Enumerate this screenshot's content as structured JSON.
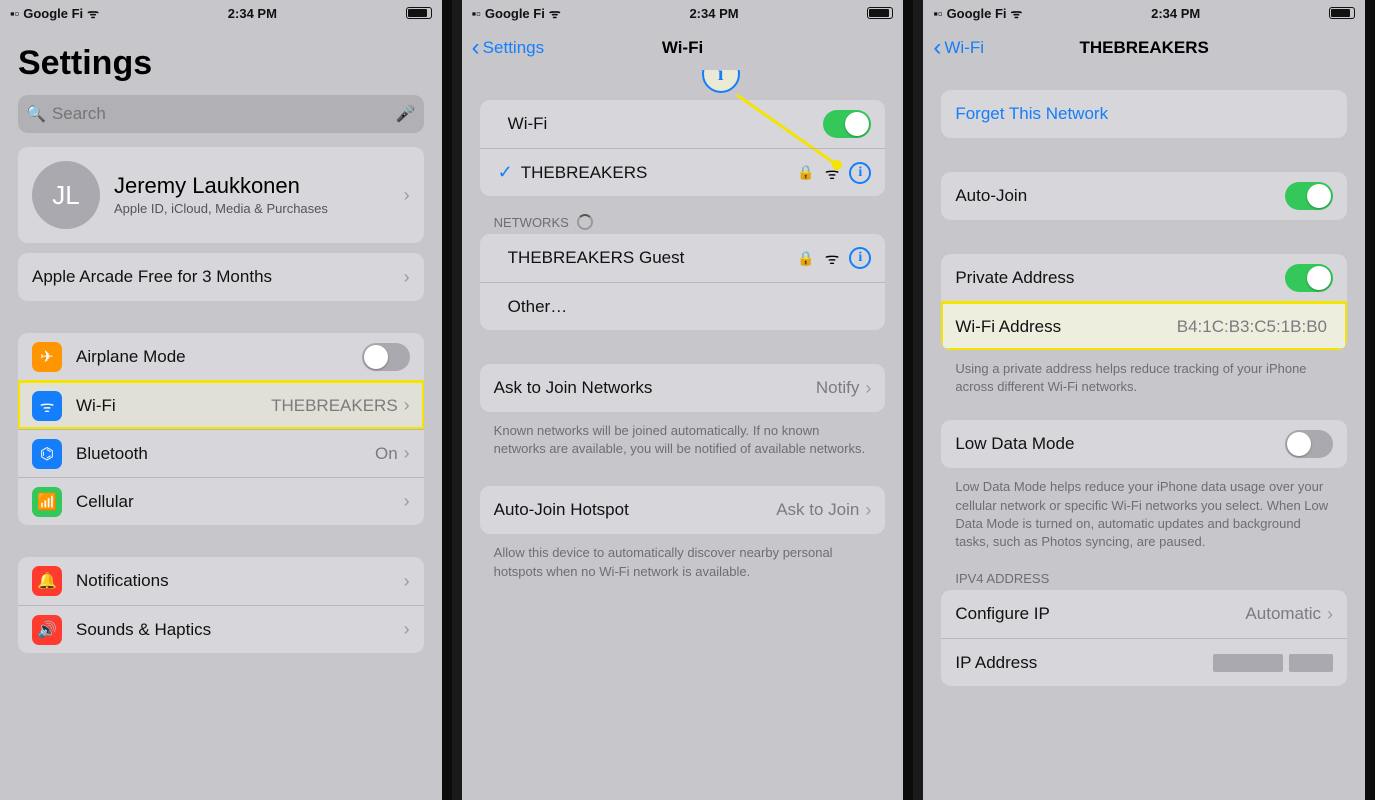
{
  "status": {
    "carrier": "Google Fi",
    "time": "2:34 PM"
  },
  "p1": {
    "bigTitle": "Settings",
    "searchPlaceholder": "Search",
    "account": {
      "initials": "JL",
      "name": "Jeremy Laukkonen",
      "sub": "Apple ID, iCloud, Media & Purchases"
    },
    "promo": "Apple Arcade Free for 3 Months",
    "rows": {
      "airplane": "Airplane Mode",
      "wifi": "Wi-Fi",
      "wifiVal": "THEBREAKERS",
      "bt": "Bluetooth",
      "btVal": "On",
      "cell": "Cellular",
      "notif": "Notifications",
      "sounds": "Sounds & Haptics"
    }
  },
  "p2": {
    "back": "Settings",
    "title": "Wi-Fi",
    "wifiLabel": "Wi-Fi",
    "connected": "THEBREAKERS",
    "netHeader": "NETWORKS",
    "guest": "THEBREAKERS Guest",
    "other": "Other…",
    "askJoin": "Ask to Join Networks",
    "askJoinVal": "Notify",
    "askJoinFooter": "Known networks will be joined automatically. If no known networks are available, you will be notified of available networks.",
    "autoHotspot": "Auto-Join Hotspot",
    "autoHotspotVal": "Ask to Join",
    "hotspotFooter": "Allow this device to automatically discover nearby personal hotspots when no Wi-Fi network is available."
  },
  "p3": {
    "back": "Wi-Fi",
    "title": "THEBREAKERS",
    "forget": "Forget This Network",
    "autoJoin": "Auto-Join",
    "privAddr": "Private Address",
    "wifiAddr": "Wi-Fi Address",
    "wifiAddrVal": "B4:1C:B3:C5:1B:B0",
    "privFooter": "Using a private address helps reduce tracking of your iPhone across different Wi-Fi networks.",
    "lowData": "Low Data Mode",
    "lowDataFooter": "Low Data Mode helps reduce your iPhone data usage over your cellular network or specific Wi-Fi networks you select. When Low Data Mode is turned on, automatic updates and background tasks, such as Photos syncing, are paused.",
    "ipv4Header": "IPV4 ADDRESS",
    "configIP": "Configure IP",
    "configIPVal": "Automatic",
    "ipAddr": "IP Address"
  }
}
